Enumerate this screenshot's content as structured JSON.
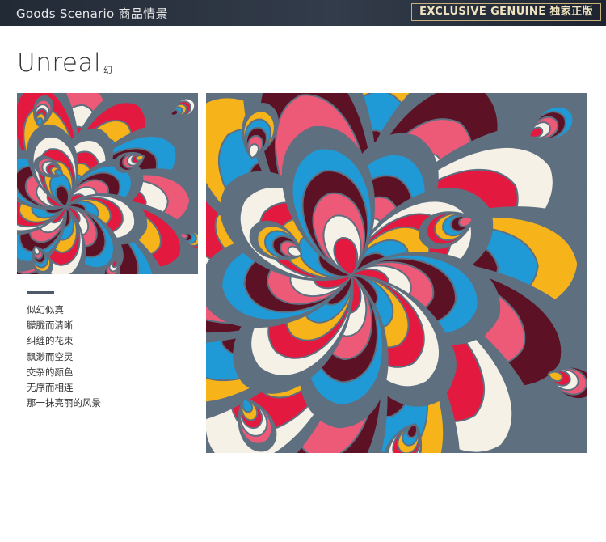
{
  "header": {
    "left_label": "Goods Scenario 商品情景",
    "right_label": "EXCLUSIVE GENUINE 独家正版"
  },
  "section": {
    "title": "Unreal",
    "title_cn": "幻"
  },
  "poem": [
    "似幻似真",
    "朦胧而清晰",
    "纠缠的花束",
    "飘渺而空灵",
    "交杂的颜色",
    "无序而相连",
    "那一抹亮丽的风景"
  ],
  "colors": {
    "header_bg": "#2a323e",
    "accent_gold": "#c9b27a",
    "pattern_red": "#e3193f",
    "pattern_yellow": "#f7b41a",
    "pattern_blue": "#1f9ad6",
    "pattern_maroon": "#5c1224",
    "pattern_pink": "#ec5a78",
    "pattern_grey": "#5e6f80",
    "pattern_cream": "#f6f1e7"
  }
}
